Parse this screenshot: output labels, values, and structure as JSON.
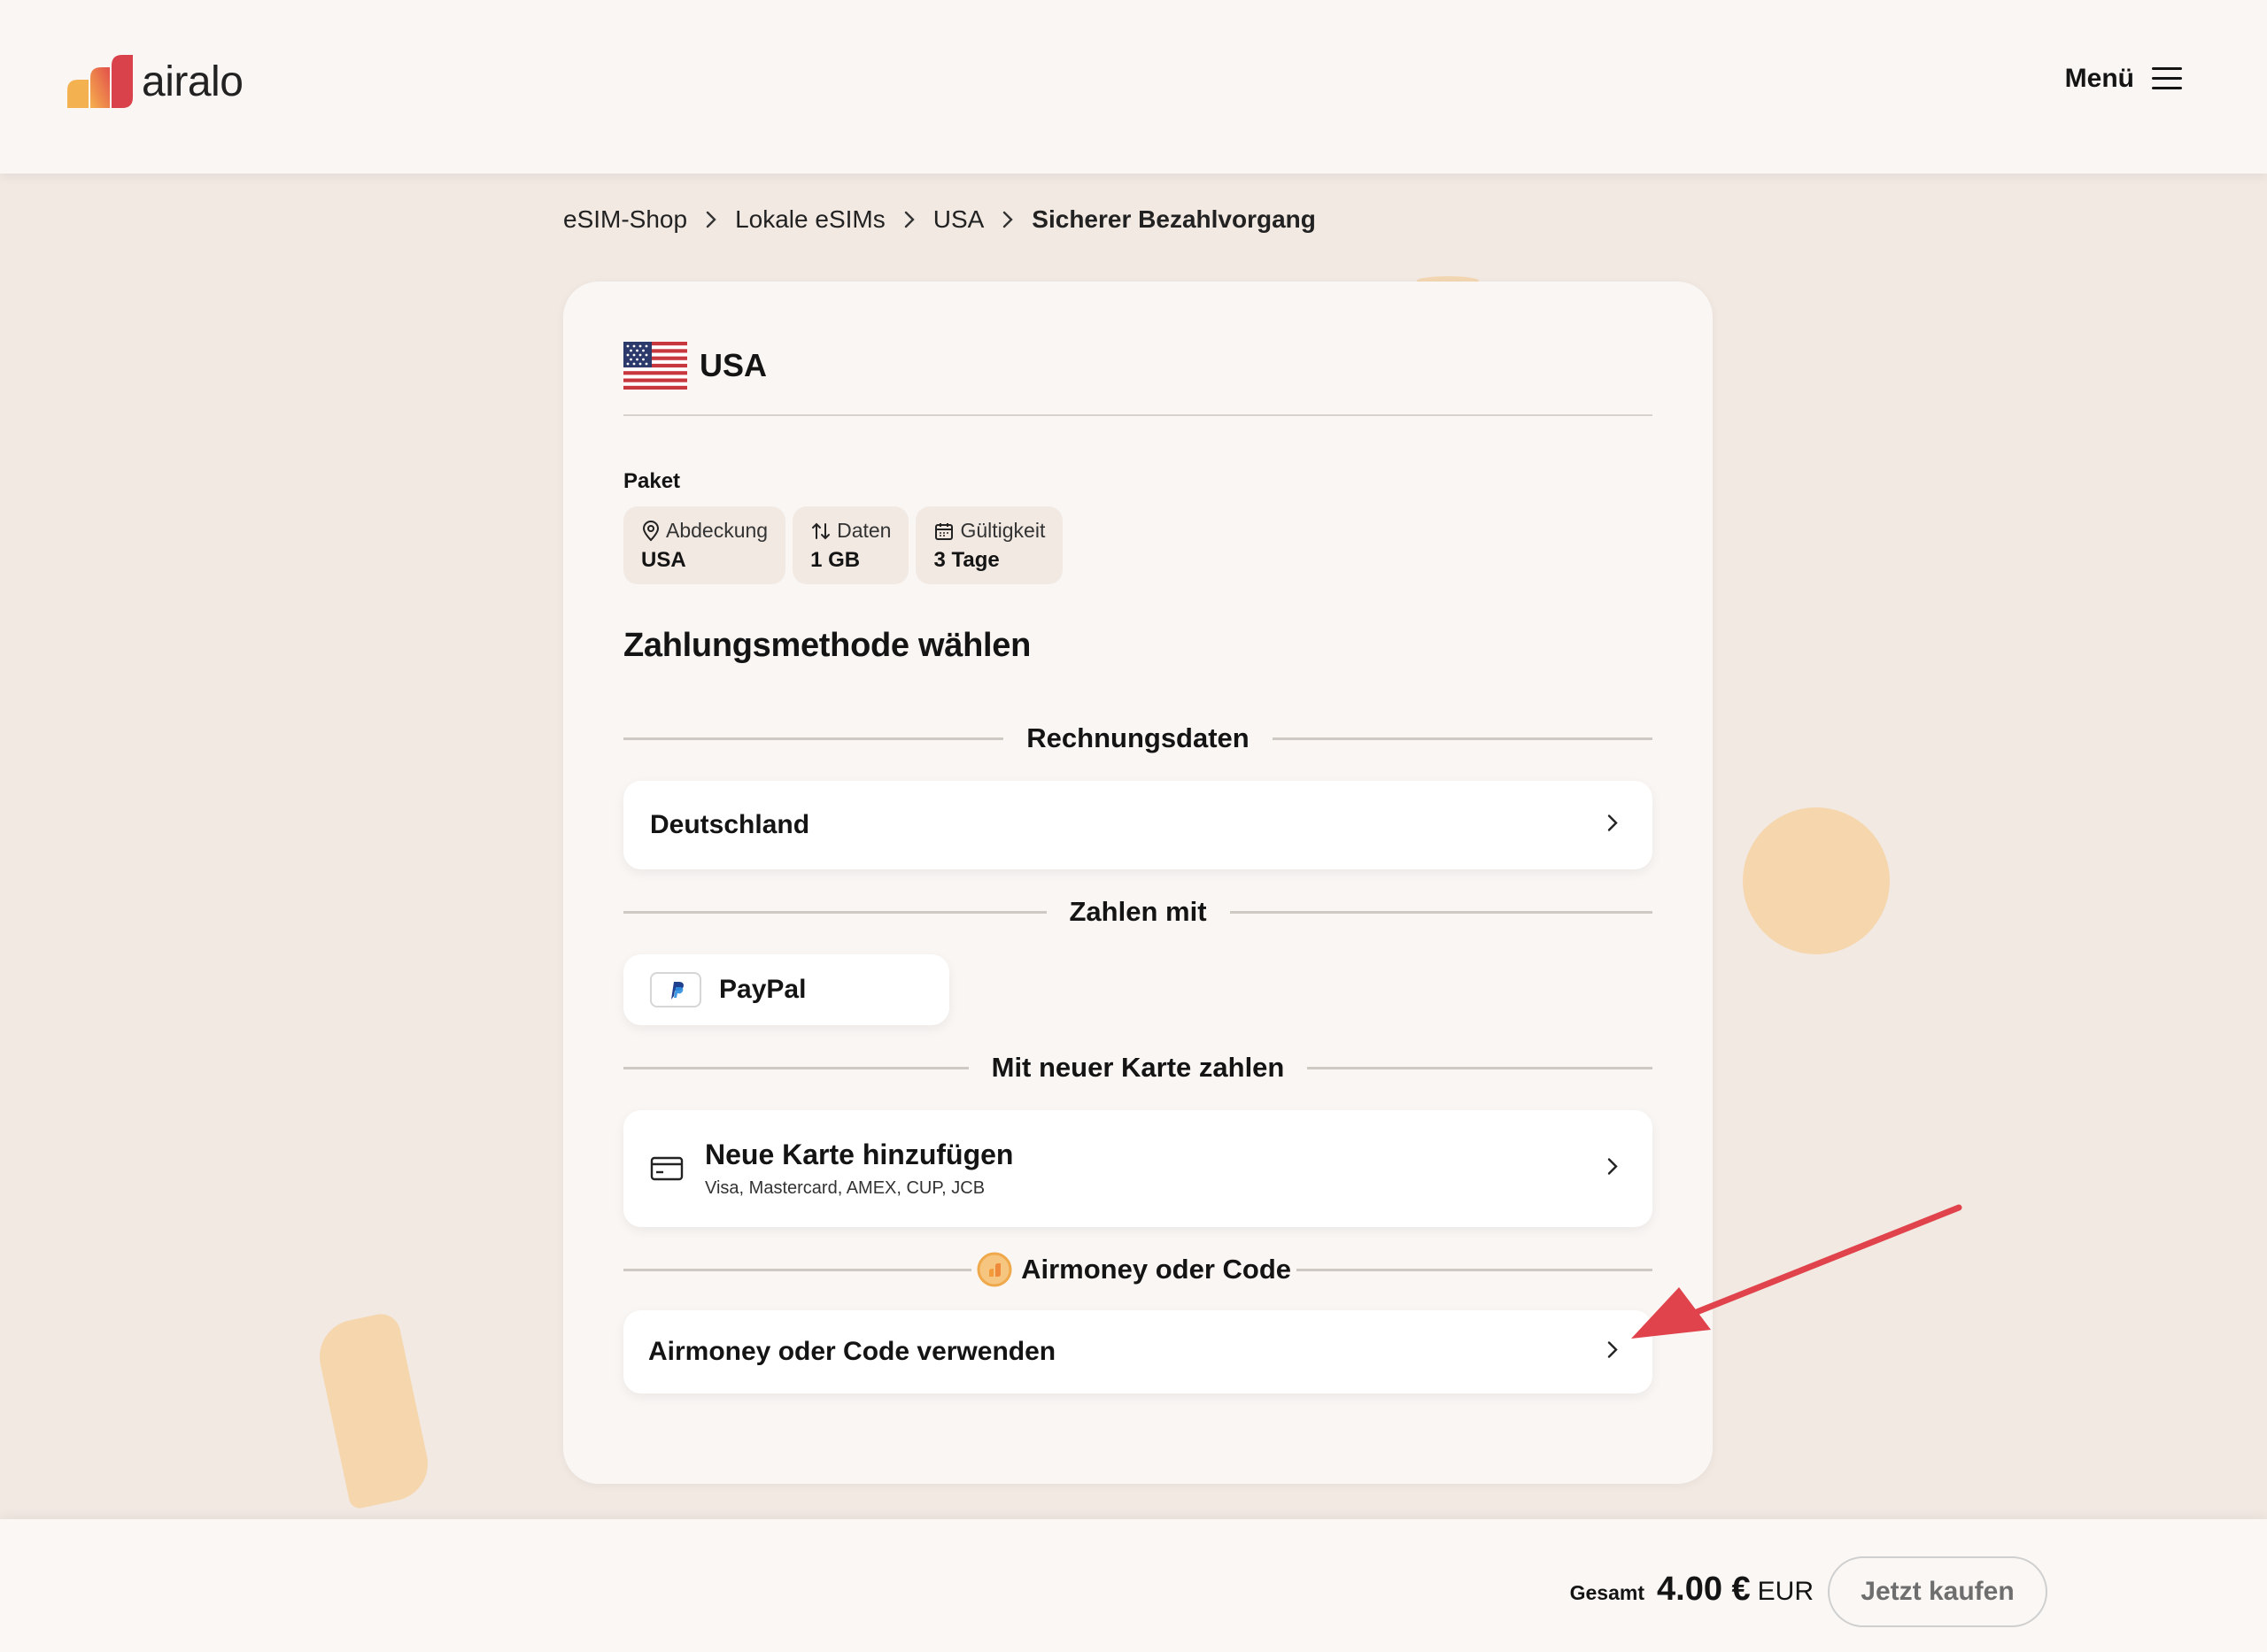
{
  "header": {
    "logo_text": "airalo",
    "menu_label": "Menü"
  },
  "breadcrumb": [
    {
      "label": "eSIM-Shop"
    },
    {
      "label": "Lokale eSIMs"
    },
    {
      "label": "USA"
    },
    {
      "label": "Sicherer Bezahlvorgang"
    }
  ],
  "card": {
    "country": "USA",
    "package_label": "Paket",
    "chips": [
      {
        "icon": "location-pin-icon",
        "label": "Abdeckung",
        "value": "USA"
      },
      {
        "icon": "data-arrows-icon",
        "label": "Daten",
        "value": "1 GB"
      },
      {
        "icon": "calendar-icon",
        "label": "Gültigkeit",
        "value": "3 Tage"
      }
    ],
    "section_title": "Zahlungsmethode wählen",
    "billing_divider": "Rechnungsdaten",
    "billing_country": "Deutschland",
    "pay_with_divider": "Zahlen mit",
    "paypal_label": "PayPal",
    "new_card_divider": "Mit neuer Karte zahlen",
    "new_card_title": "Neue Karte hinzufügen",
    "new_card_sub": "Visa, Mastercard, AMEX, CUP, JCB",
    "airmoney_divider": "Airmoney oder Code",
    "airmoney_row": "Airmoney oder Code verwenden"
  },
  "footer": {
    "total_label": "Gesamt",
    "total_amount": "4.00 €",
    "total_currency": "EUR",
    "buy_button": "Jetzt kaufen"
  },
  "colors": {
    "accent_arrow": "#e0434b",
    "decor": "#f5d6ad",
    "background": "#f2e9e3"
  }
}
